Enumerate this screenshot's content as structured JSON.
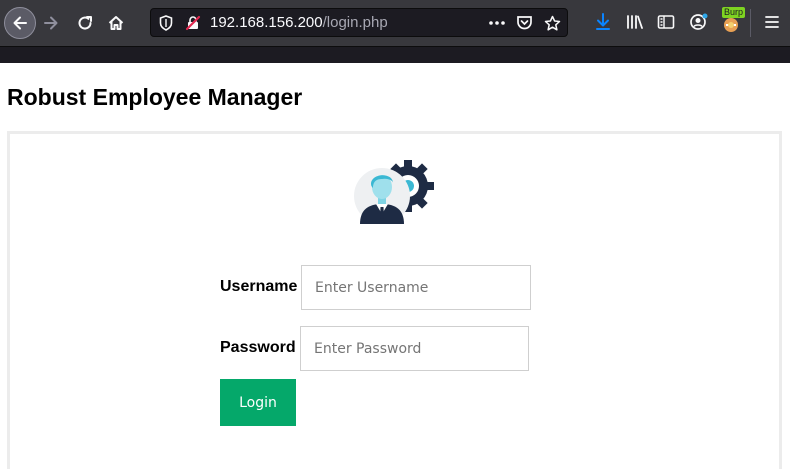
{
  "browser": {
    "url_host": "192.168.156.200",
    "url_path": "/login.php",
    "burp_badge": "Burp",
    "accent_color": "#0a84ff"
  },
  "page": {
    "title": "Robust Employee Manager"
  },
  "login_form": {
    "username_label": "Username",
    "username_placeholder": "Enter Username",
    "username_value": "",
    "password_label": "Password",
    "password_placeholder": "Enter Password",
    "password_value": "",
    "submit_label": "Login",
    "submit_color": "#05a86a"
  },
  "icons": {
    "back": "arrow-left-icon",
    "forward": "arrow-right-icon",
    "reload": "reload-icon",
    "home": "home-icon",
    "shield": "tracking-shield-icon",
    "insecure": "insecure-lock-icon",
    "more": "ellipsis-icon",
    "pocket": "pocket-icon",
    "bookmark": "star-icon",
    "downloads": "download-icon",
    "library": "library-icon",
    "sidebar": "sidebar-icon",
    "account": "account-icon",
    "extension": "burp-extension-icon",
    "menu": "hamburger-menu-icon",
    "avatar": "employee-gear-icon"
  }
}
